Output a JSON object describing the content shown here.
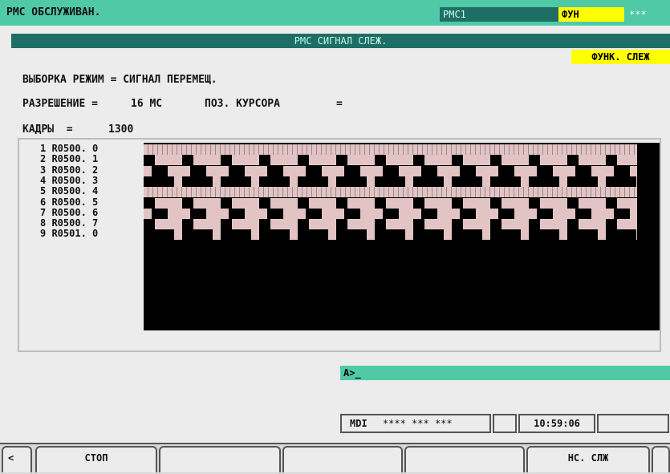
{
  "topbar": {
    "title": "РМС ОБСЛУЖИВАН.",
    "pmc_tag": "РМС1",
    "fun_tag": "ФУН",
    "stars_tag": "***"
  },
  "header": {
    "title": "РМС СИГНАЛ СЛЕЖ.",
    "mode_badge": "ФУНК. СЛЕЖ"
  },
  "info": {
    "sampling_line": "ВЫБОРКА РЕЖИМ = СИГНАЛ ПЕРЕМЕЩ.",
    "resolution_label": "РАЗРЕШЕНИЕ =",
    "resolution_value": "16 МС",
    "cursor_label": "ПОЗ. КУРСОРА",
    "cursor_eq": "=",
    "frames_label": "КАДРЫ  =",
    "frames_value": "1300"
  },
  "signals": [
    {
      "label": "1 R0500. 0",
      "pattern": "low"
    },
    {
      "label": "2 R0500. 1",
      "pattern": "pulse-sparse"
    },
    {
      "label": "3 R0500. 2",
      "pattern": "pulse-medium"
    },
    {
      "label": "4 R0500. 3",
      "pattern": "mostly-high"
    },
    {
      "label": "5 R0500. 4",
      "pattern": "low"
    },
    {
      "label": "6 R0500. 5",
      "pattern": "pulse-sparse"
    },
    {
      "label": "7 R0500. 6",
      "pattern": "pulse-medium"
    },
    {
      "label": "8 R0500. 7",
      "pattern": "pulse-sparse"
    },
    {
      "label": "9 R0501. 0",
      "pattern": "mostly-high"
    }
  ],
  "prompt": {
    "text": "A>_"
  },
  "status": {
    "mode": "MDI",
    "stars": "**** *** ***",
    "time": "10:59:06"
  },
  "softkeys": [
    {
      "label": "<",
      "name": "softkey-prev"
    },
    {
      "label": "СТОП",
      "name": "softkey-stop"
    },
    {
      "label": "",
      "name": "softkey-2"
    },
    {
      "label": "",
      "name": "softkey-3"
    },
    {
      "label": "",
      "name": "softkey-4"
    },
    {
      "label": "НС. СЛЖ",
      "name": "softkey-ns-slzh"
    },
    {
      "label": "",
      "name": "softkey-next"
    }
  ],
  "colors": {
    "topbar": "#4fc9a6",
    "header": "#1e6e66",
    "highlight": "#ffff00",
    "trace_low": "#e2c4c4",
    "trace_high": "#000000"
  }
}
